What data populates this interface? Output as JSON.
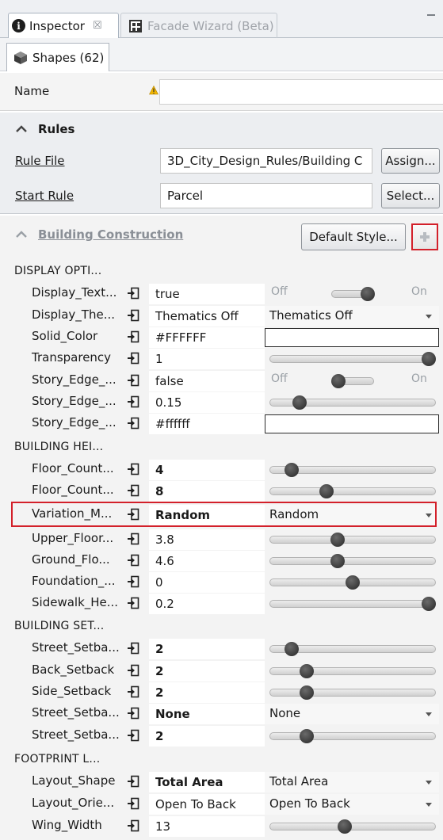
{
  "tabs": [
    {
      "label": "Inspector",
      "close": "☒"
    },
    {
      "label": "Facade Wizard (Beta)"
    }
  ],
  "shapes_tab": {
    "label": "Shapes (62)"
  },
  "name": {
    "label": "Name",
    "value": ""
  },
  "rules": {
    "title": "Rules",
    "rule_file": {
      "label": "Rule File",
      "value": "3D_City_Design_Rules/Building C",
      "button": "Assign..."
    },
    "start_rule": {
      "label": "Start Rule",
      "value": "Parcel",
      "button": "Select..."
    }
  },
  "building_construction": {
    "title": "Building Construction",
    "default_style_button": "Default Style...",
    "add_button": "+"
  },
  "groups": {
    "display": "DISPLAY OPTI...",
    "height": "BUILDING HEI...",
    "setback": "BUILDING SET...",
    "footprint": "FOOTPRINT L..."
  },
  "toggle_labels": {
    "off": "Off",
    "on": "On"
  },
  "attributes": {
    "display_text": {
      "name": "Display_Text...",
      "value": "true",
      "control": "toggle",
      "state": "on"
    },
    "display_thematics": {
      "name": "Display_The...",
      "value": "Thematics Off",
      "combo": "Thematics Off"
    },
    "solid_color": {
      "name": "Solid_Color",
      "value": "#FFFFFF",
      "color": "#FFFFFF"
    },
    "transparency": {
      "name": "Transparency",
      "value": "1",
      "fraction": 1.0
    },
    "story_edge_1": {
      "name": "Story_Edge_...",
      "value": "false",
      "control": "toggle",
      "state": "off"
    },
    "story_edge_2": {
      "name": "Story_Edge_...",
      "value": "0.15",
      "fraction": 0.15
    },
    "story_edge_3": {
      "name": "Story_Edge_...",
      "value": "#ffffff",
      "color": "#ffffff"
    },
    "floor_count_1": {
      "name": "Floor_Count...",
      "value": "4",
      "fraction": 0.1
    },
    "floor_count_2": {
      "name": "Floor_Count...",
      "value": "8",
      "fraction": 0.33
    },
    "variation_m": {
      "name": "Variation_M...",
      "value": "Random",
      "combo": "Random"
    },
    "upper_floor": {
      "name": "Upper_Floor...",
      "value": "3.8",
      "fraction": 0.4
    },
    "ground_flo": {
      "name": "Ground_Flo...",
      "value": "4.6",
      "fraction": 0.4
    },
    "foundation": {
      "name": "Foundation_...",
      "value": "0",
      "fraction": 0.5
    },
    "sidewalk_he": {
      "name": "Sidewalk_He...",
      "value": "0.2",
      "fraction": 1.0
    },
    "street_setback_1": {
      "name": "Street_Setba...",
      "value": "2",
      "fraction": 0.1
    },
    "back_setback": {
      "name": "Back_Setback",
      "value": "2",
      "fraction": 0.2
    },
    "side_setback": {
      "name": "Side_Setback",
      "value": "2",
      "fraction": 0.2
    },
    "street_setback_2": {
      "name": "Street_Setba...",
      "value": "None",
      "combo": "None"
    },
    "street_setback_3": {
      "name": "Street_Setba...",
      "value": "2",
      "fraction": 0.2
    },
    "layout_shape": {
      "name": "Layout_Shape",
      "value": "Total Area",
      "combo": "Total Area"
    },
    "layout_orie": {
      "name": "Layout_Orie...",
      "value": "Open To Back",
      "combo": "Open To Back"
    },
    "wing_width": {
      "name": "Wing_Width",
      "value": "13",
      "fraction": 0.45
    }
  },
  "colors": {
    "highlight": "#d3202a"
  }
}
